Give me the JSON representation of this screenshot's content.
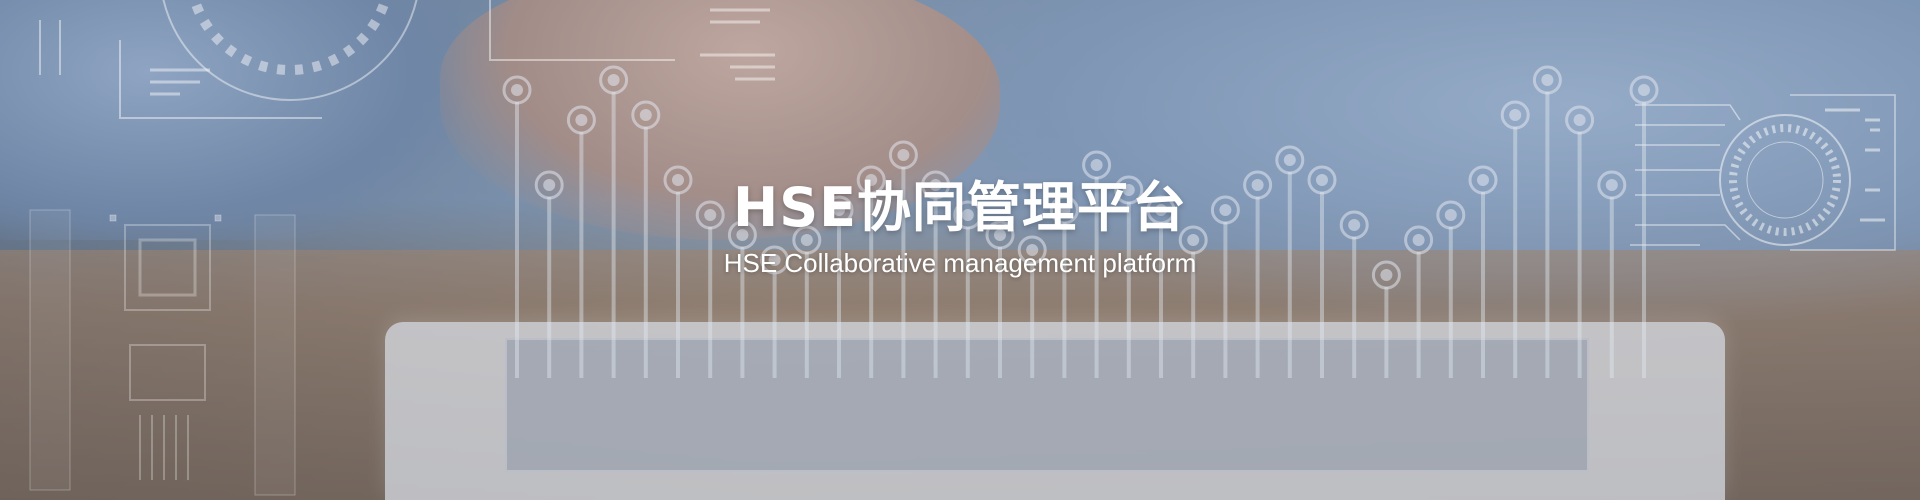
{
  "banner": {
    "title": "HSE协同管理平台",
    "subtitle": "HSE Collaborative management platform"
  },
  "colors": {
    "overlay": "#7f95b0",
    "text": "#ffffff",
    "line": "#d8dde6"
  },
  "icons": [
    "gauge-circle-icon",
    "radar-circle-icon",
    "data-pin-icon"
  ]
}
